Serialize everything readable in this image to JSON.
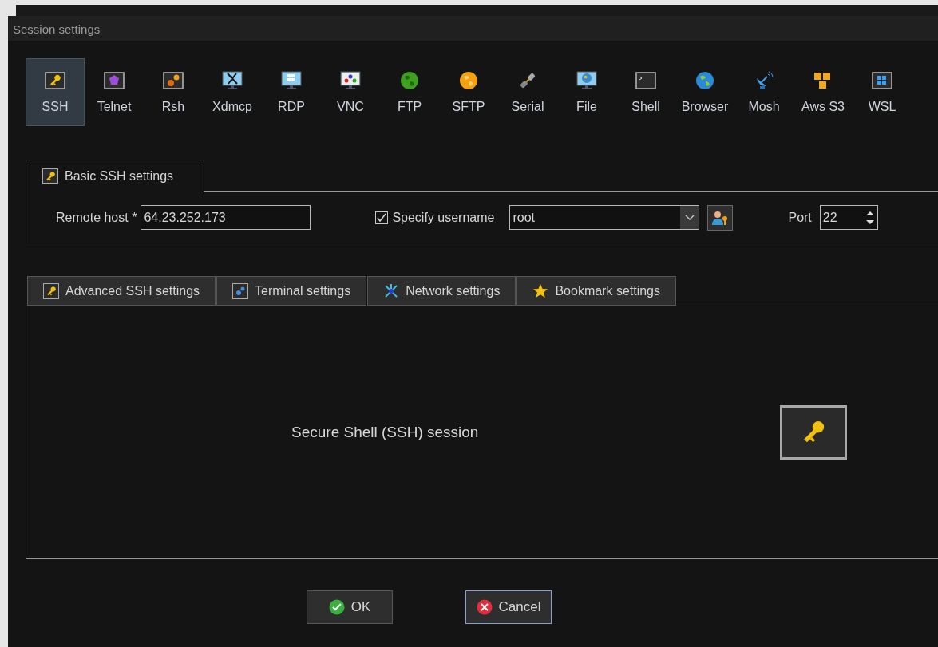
{
  "window": {
    "title": "Session settings"
  },
  "session_types": [
    {
      "label": "SSH",
      "selected": true
    },
    {
      "label": "Telnet",
      "selected": false
    },
    {
      "label": "Rsh",
      "selected": false
    },
    {
      "label": "Xdmcp",
      "selected": false
    },
    {
      "label": "RDP",
      "selected": false
    },
    {
      "label": "VNC",
      "selected": false
    },
    {
      "label": "FTP",
      "selected": false
    },
    {
      "label": "SFTP",
      "selected": false
    },
    {
      "label": "Serial",
      "selected": false
    },
    {
      "label": "File",
      "selected": false
    },
    {
      "label": "Shell",
      "selected": false
    },
    {
      "label": "Browser",
      "selected": false
    },
    {
      "label": "Mosh",
      "selected": false
    },
    {
      "label": "Aws S3",
      "selected": false
    },
    {
      "label": "WSL",
      "selected": false
    }
  ],
  "basic_tab": {
    "label": "Basic SSH settings"
  },
  "remote_host": {
    "label": "Remote host *",
    "value": "64.23.252.173"
  },
  "specify_username": {
    "label": "Specify username",
    "checked": true,
    "value": "root"
  },
  "port": {
    "label": "Port",
    "value": "22"
  },
  "tabs": [
    {
      "label": "Advanced SSH settings",
      "selected": false
    },
    {
      "label": "Terminal settings",
      "selected": false
    },
    {
      "label": "Network settings",
      "selected": false
    },
    {
      "label": "Bookmark settings",
      "selected": false
    }
  ],
  "description": "Secure Shell (SSH) session",
  "buttons": [
    {
      "label": "OK",
      "kind": "ok",
      "focused": false
    },
    {
      "label": "Cancel",
      "kind": "cancel",
      "focused": true
    }
  ]
}
